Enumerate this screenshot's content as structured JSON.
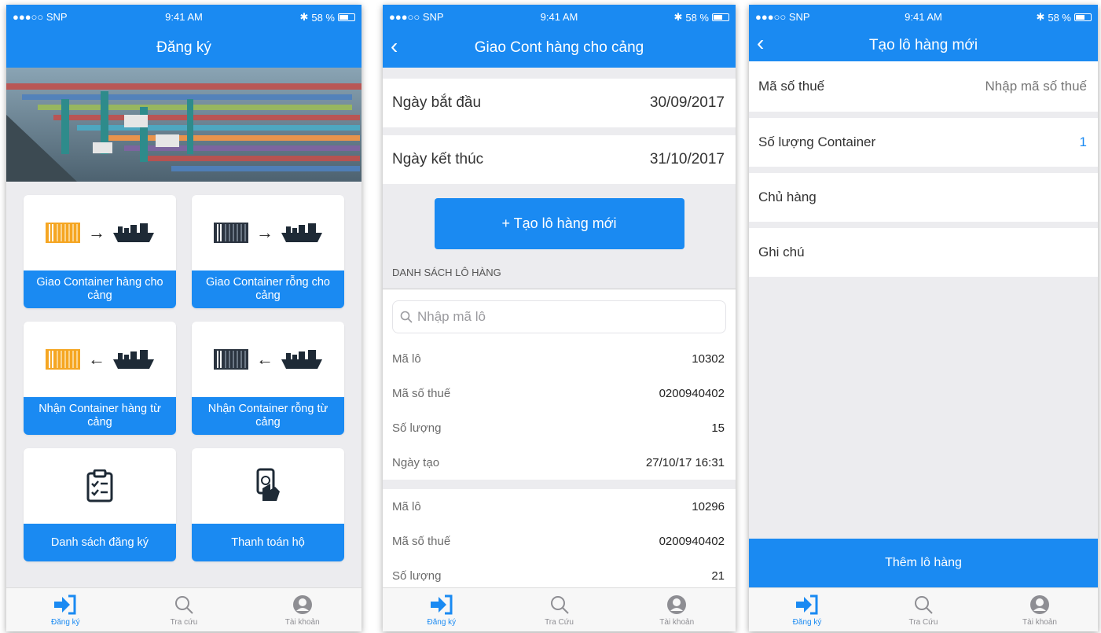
{
  "status": {
    "carrier": "●●●○○ SNP",
    "time": "9:41 AM",
    "battery": "58 %"
  },
  "tabs": {
    "register": "Đăng ký",
    "lookup1": "Tra cứu",
    "lookup2": "Tra Cứu",
    "account": "Tài khoản"
  },
  "screen1": {
    "title": "Đăng ký",
    "tiles": [
      "Giao Container hàng cho cảng",
      "Giao Container rỗng cho cảng",
      "Nhận Container hàng từ cảng",
      "Nhận Container rỗng từ cảng",
      "Danh sách đăng ký",
      "Thanh toán hộ"
    ]
  },
  "screen2": {
    "title": "Giao Cont hàng cho cảng",
    "start_label": "Ngày bắt đầu",
    "start_value": "30/09/2017",
    "end_label": "Ngày kết thúc",
    "end_value": "31/10/2017",
    "create_button": "+ Tạo lô hàng mới",
    "section_title": "DANH SÁCH LÔ HÀNG",
    "search_placeholder": "Nhập mã lô",
    "lot1": [
      {
        "k": "Mã lô",
        "v": "10302"
      },
      {
        "k": "Mã số thuế",
        "v": "0200940402"
      },
      {
        "k": "Số lượng",
        "v": "15"
      },
      {
        "k": "Ngày tạo",
        "v": "27/10/17 16:31"
      }
    ],
    "lot2": [
      {
        "k": "Mã lô",
        "v": "10296"
      },
      {
        "k": "Mã số thuế",
        "v": "0200940402"
      },
      {
        "k": "Số lượng",
        "v": "21"
      }
    ]
  },
  "screen3": {
    "title": "Tạo lô hàng mới",
    "tax_label": "Mã số thuế",
    "tax_placeholder": "Nhập mã số thuế",
    "qty_label": "Số lượng Container",
    "qty_value": "1",
    "owner_label": "Chủ hàng",
    "note_label": "Ghi chú",
    "add_button": "Thêm lô hàng"
  },
  "colors": {
    "primary": "#1a8af2",
    "container_orange": "#f5a623"
  }
}
